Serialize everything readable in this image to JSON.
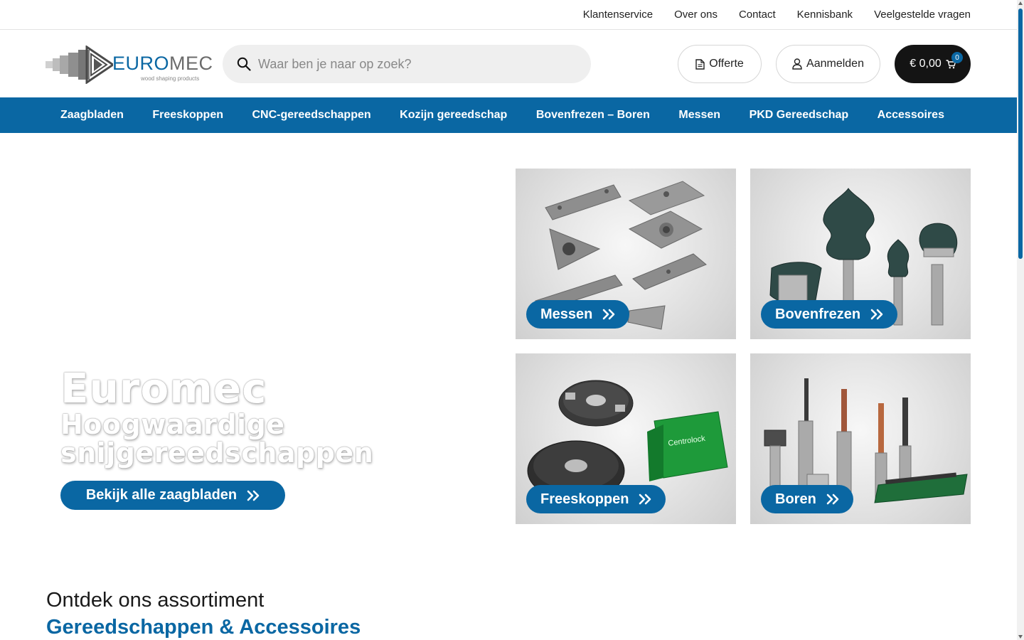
{
  "topbar": {
    "links": [
      "Klantenservice",
      "Over ons",
      "Contact",
      "Kennisbank",
      "Veelgestelde vragen"
    ]
  },
  "header": {
    "logo": {
      "brand_part1": "EURO",
      "brand_part2": "MEC",
      "tagline": "wood shaping products"
    },
    "search": {
      "placeholder": "Waar ben je naar op zoek?",
      "value": ""
    },
    "offerte_label": "Offerte",
    "login_label": "Aanmelden",
    "cart": {
      "total": "€ 0,00",
      "count": "0"
    }
  },
  "nav": {
    "items": [
      "Zaagbladen",
      "Freeskoppen",
      "CNC-gereedschappen",
      "Kozijn gereedschap",
      "Bovenfrezen – Boren",
      "Messen",
      "PKD Gereedschap",
      "Accessoires"
    ]
  },
  "hero": {
    "title": "Euromec",
    "subtitle_line1": "Hoogwaardige",
    "subtitle_line2": "snijgereedschappen",
    "cta_label": "Bekijk alle zaagbladen"
  },
  "tiles": [
    {
      "label": "Messen"
    },
    {
      "label": "Bovenfrezen"
    },
    {
      "label": "Freeskoppen"
    },
    {
      "label": "Boren"
    }
  ],
  "section": {
    "kicker": "Ontdek ons assortiment",
    "title": "Gereedschappen & Accessoires"
  },
  "colors": {
    "brand_blue": "#0a67a3",
    "cart_dark": "#141414"
  },
  "icons": [
    "search-icon",
    "document-icon",
    "user-icon",
    "cart-icon",
    "double-chevron-right-icon"
  ]
}
